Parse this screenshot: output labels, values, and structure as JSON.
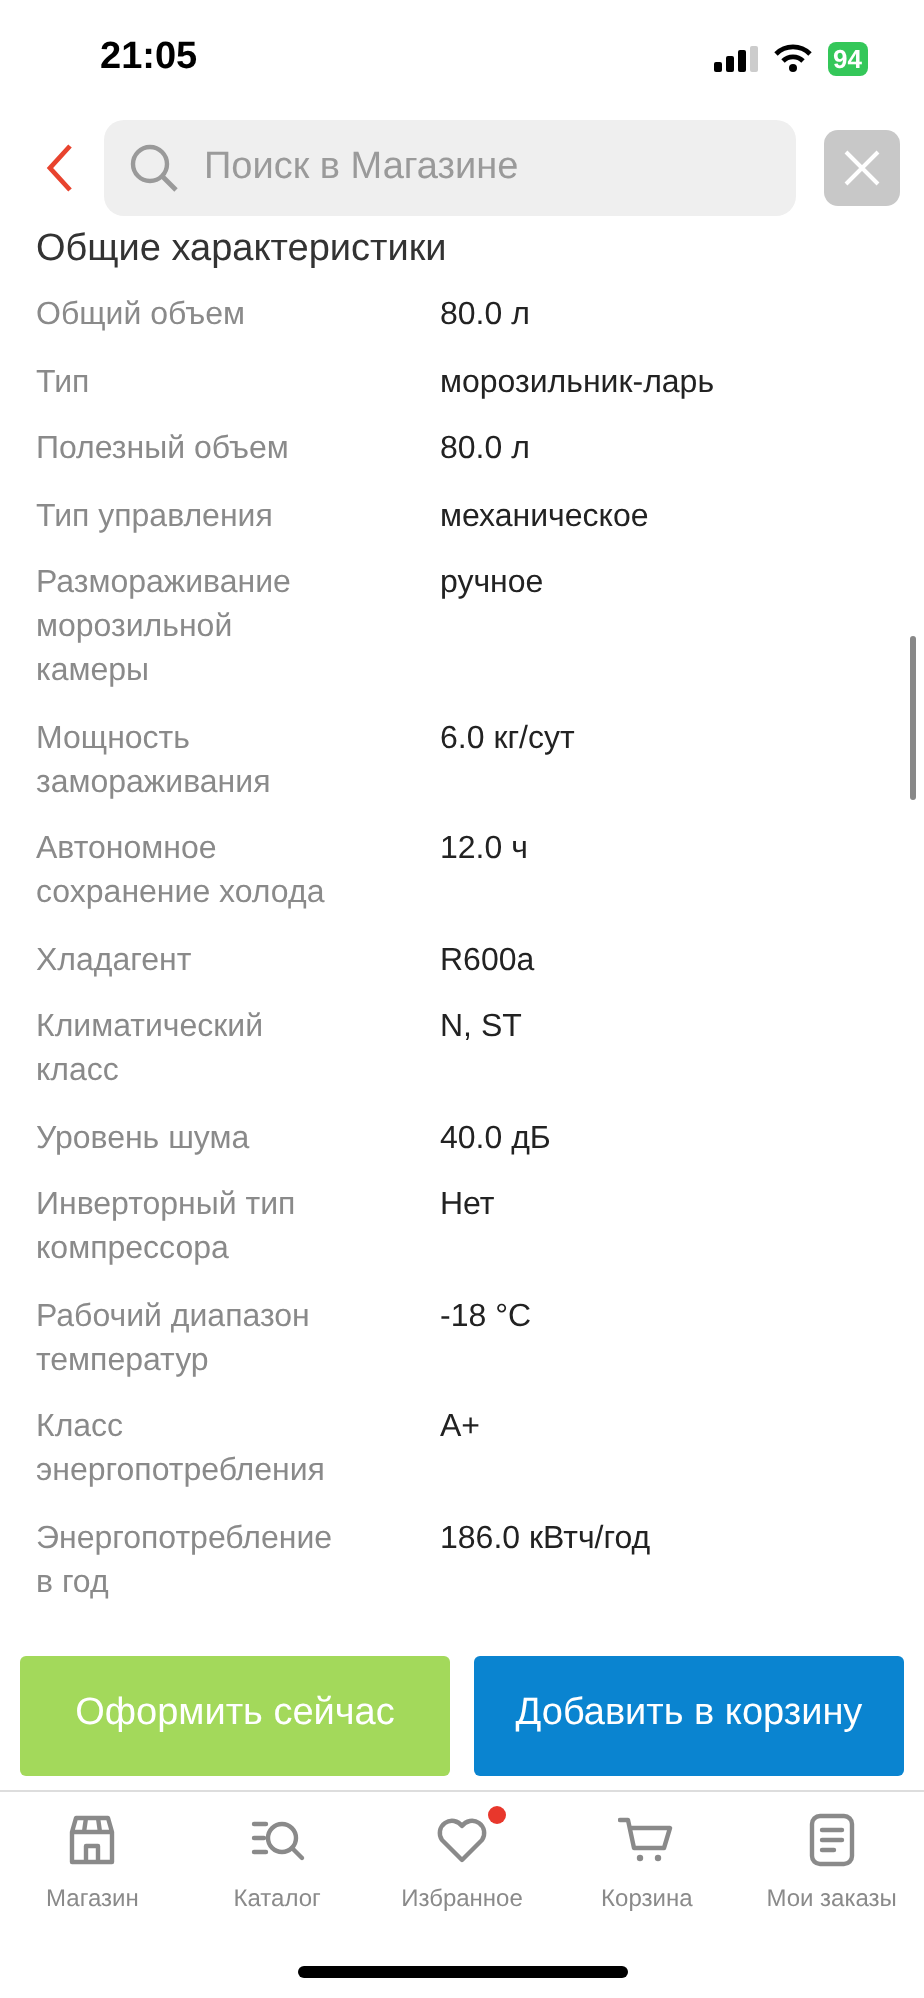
{
  "status_bar": {
    "time": "21:05",
    "battery": "94"
  },
  "search": {
    "placeholder": "Поиск в Магазине"
  },
  "section_title": "Общие характеристики",
  "specs": [
    {
      "label": "Общий объем",
      "value": "80.0 л"
    },
    {
      "label": "Тип",
      "value": "морозильник-ларь"
    },
    {
      "label": "Полезный объем",
      "value": "80.0 л"
    },
    {
      "label": "Тип управления",
      "value": "механическое"
    },
    {
      "label": "Размораживание морозильной камеры",
      "value": "ручное"
    },
    {
      "label": "Мощность замораживания",
      "value": "6.0 кг/сут"
    },
    {
      "label": "Автономное сохранение холода",
      "value": "12.0 ч"
    },
    {
      "label": "Хладагент",
      "value": "R600a"
    },
    {
      "label": "Климатический класс",
      "value": "N, ST"
    },
    {
      "label": "Уровень шума",
      "value": "40.0 дБ"
    },
    {
      "label": "Инверторный тип компрессора",
      "value": "Нет"
    },
    {
      "label": "Рабочий диапазон температур",
      "value": "-18 °C"
    },
    {
      "label": "Класс энергопотребления",
      "value": "A+"
    },
    {
      "label": "Энергопотребление в год",
      "value": "186.0 кВтч/год"
    }
  ],
  "actions": [
    {
      "label": "Оформить сейчас",
      "kind": "buy"
    },
    {
      "label": "Добавить в корзину",
      "kind": "cart"
    }
  ],
  "nav": [
    {
      "label": "Магазин",
      "kind": "store",
      "badge": false
    },
    {
      "label": "Каталог",
      "kind": "catalog",
      "badge": false
    },
    {
      "label": "Избранное",
      "kind": "favorites",
      "badge": true
    },
    {
      "label": "Корзина",
      "kind": "cart",
      "badge": false
    },
    {
      "label": "Мои заказы",
      "kind": "orders",
      "badge": false
    }
  ]
}
